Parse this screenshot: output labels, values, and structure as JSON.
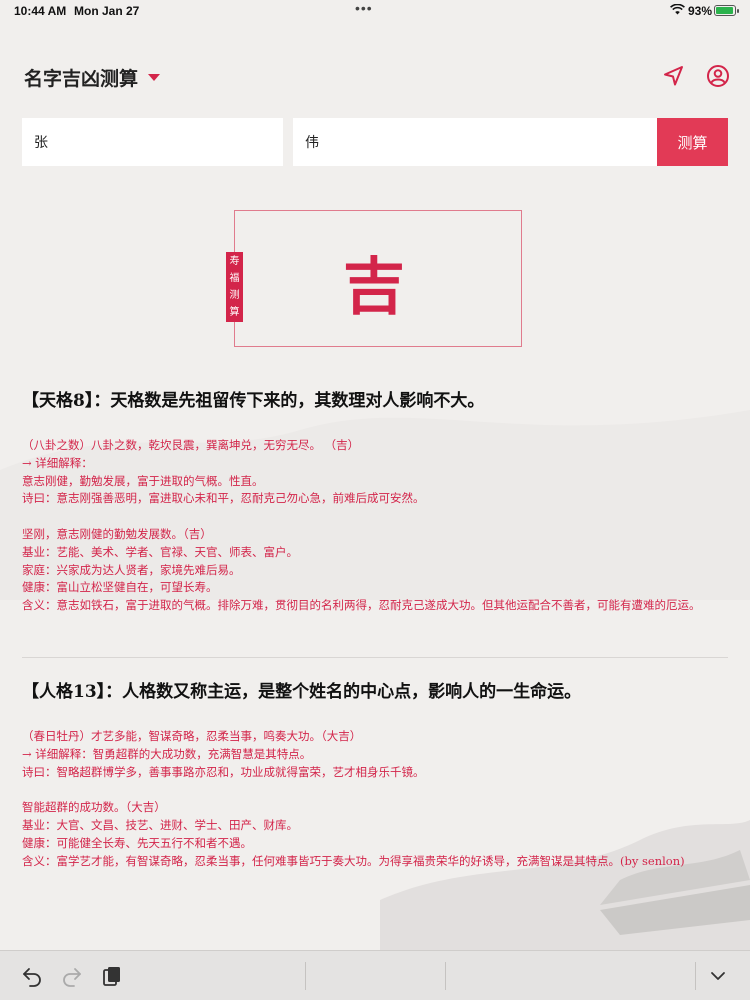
{
  "status_bar": {
    "time": "10:44 AM",
    "date": "Mon Jan 27",
    "battery_percent": "93%",
    "battery_level": 0.93
  },
  "header": {
    "title": "名字吉凶测算"
  },
  "form": {
    "surname_value": "张",
    "given_name_value": "伟",
    "submit_label": "测算"
  },
  "result": {
    "stamp_chars": [
      "寿",
      "福",
      "测",
      "算"
    ],
    "verdict": "吉"
  },
  "sections": [
    {
      "title": "【天格8】：天格数是先祖留传下来的，其数理对人影响不大。",
      "lines": [
        "（八卦之数）八卦之数，乾坎艮震，巽离坤兑，无穷无尽。  （吉）",
        "→ 详细解释：",
        "意志刚健，勤勉发展，富于进取的气概。性直。",
        "诗曰：意志刚强善恶明，富进取心未和平，忍耐克己勿心急，前难后成可安然。",
        "",
        "坚刚，意志刚健的勤勉发展数。（吉）",
        "基业：艺能、美术、学者、官禄、天官、师表、富户。",
        "家庭：兴家成为达人贤者，家境先难后易。",
        "健康：富山立松坚健自在，可望长寿。",
        "含义：意志如铁石，富于进取的气概。排除万难，贯彻目的名利两得，忍耐克己遂成大功。但其他运配合不善者，可能有遭难的厄运。"
      ]
    },
    {
      "title": "【人格13】：人格数又称主运，是整个姓名的中心点，影响人的一生命运。",
      "lines": [
        "（春日牡丹）才艺多能，智谋奇略，忍柔当事，鸣奏大功。（大吉）",
        "→ 详细解释：智勇超群的大成功数，充满智慧是其特点。",
        "诗曰：智略超群博学多，善事事路亦忍和，功业成就得富荣，艺才相身乐千镜。",
        "",
        "智能超群的成功数。（大吉）",
        "基业：大官、文昌、技艺、进财、学士、田产、财库。",
        "健康：可能健全长寿、先天五行不和者不遇。",
        "含义：富学艺才能，有智谋奇略，忍柔当事，任何难事皆巧于奏大功。为得享福贵荣华的好诱导，充满智谋是其特点。(by senlon)"
      ]
    }
  ],
  "colors": {
    "accent": "#d3254a",
    "button": "#e23a56",
    "background": "#f1efed"
  },
  "icons": {
    "nav_location": "location-arrow-icon",
    "nav_profile": "user-circle-icon",
    "undo": "undo-icon",
    "redo": "redo-icon",
    "clipboard": "clipboard-icon",
    "collapse": "chevron-down-icon"
  }
}
